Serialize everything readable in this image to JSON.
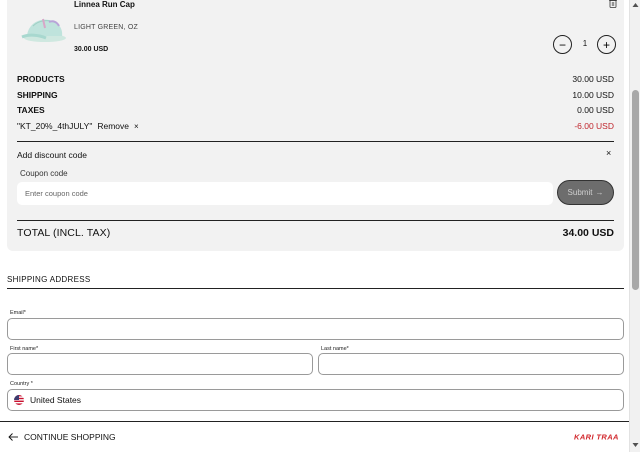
{
  "cart": {
    "item": {
      "name": "Linnea Run Cap",
      "variant": "LIGHT GREEN, OZ",
      "price": "30.00 USD",
      "quantity": "1",
      "minus_label": "−",
      "plus_label": "+"
    },
    "summary": {
      "products_label": "PRODUCTS",
      "products_value": "30.00 USD",
      "shipping_label": "SHIPPING",
      "shipping_value": "10.00 USD",
      "taxes_label": "TAXES",
      "taxes_value": "0.00 USD",
      "coupon_code": "\"KT_20%_4thJULY\"",
      "coupon_remove": "Remove",
      "coupon_remove_x": "×",
      "coupon_value": "-6.00 USD"
    },
    "discount": {
      "title": "Add discount code",
      "close": "×",
      "label": "Coupon code",
      "placeholder": "Enter coupon code",
      "submit_label": "Submit",
      "submit_arrow": "→"
    },
    "total": {
      "label": "TOTAL (INCL. TAX)",
      "value": "34.00 USD"
    }
  },
  "shipping_address": {
    "title": "SHIPPING ADDRESS",
    "email_label": "Email*",
    "first_name_label": "First name*",
    "last_name_label": "Last name*",
    "country_label": "Country *",
    "country_value": "United States"
  },
  "footer": {
    "continue_label": "CONTINUE SHOPPING",
    "brand": "KARI TRAA"
  },
  "colors": {
    "panel_bg": "#f2f2f2",
    "discount_red": "#c0262d",
    "submit_bg": "#6d6d6d",
    "brand_red": "#d1262b"
  },
  "icons": [
    "trash-icon",
    "minus-icon",
    "plus-icon",
    "close-icon",
    "arrow-right-icon",
    "us-flag-icon",
    "arrow-left-icon"
  ]
}
